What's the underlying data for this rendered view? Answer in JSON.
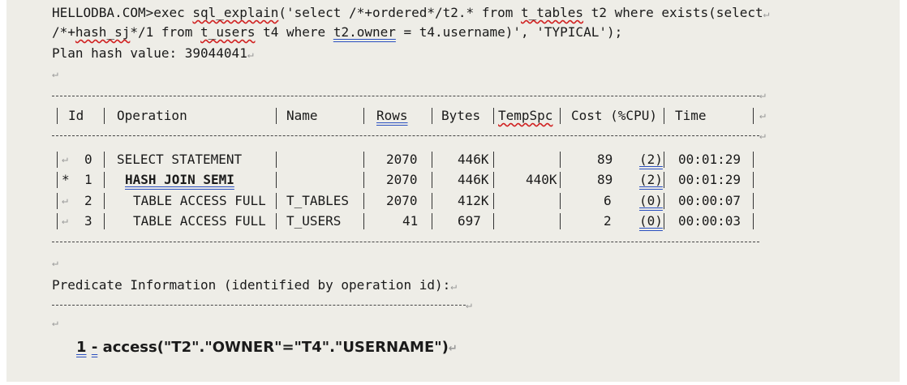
{
  "command": {
    "line1_prefix": "HELLODBA.COM>exec ",
    "line1_fn": "sql_explain",
    "line1_mid": "('select /*+ordered*/t2.* from ",
    "line1_tbl": "t_tables",
    "line1_end": " t2 where exists(select",
    "line2_pre": "/*+",
    "line2_hint": "hash_sj",
    "line2_mid": "*/1 from ",
    "line2_tbl": "t_users",
    "line2_mid2": " t4 where ",
    "line2_owner": "t2.owner",
    "line2_end": " = t4.username)', 'TYPICAL');"
  },
  "plan_hash": "Plan hash value: 39044041",
  "headers": {
    "id": "Id",
    "operation": "Operation",
    "name": "Name",
    "rows": "Rows",
    "bytes": "Bytes",
    "tempspc": "TempSpc",
    "cost": "Cost (%CPU)",
    "time": "Time"
  },
  "rows": [
    {
      "id": "0",
      "operation": "SELECT STATEMENT",
      "name": "",
      "rows": "2070",
      "bytes": "446K",
      "tempspc": "",
      "cost": "89",
      "cpu": "(2)",
      "time": "00:01:29"
    },
    {
      "id": "1",
      "operation": "HASH JOIN SEMI",
      "name": "",
      "rows": "2070",
      "bytes": "446K",
      "tempspc": "440K",
      "cost": "89",
      "cpu": "(2)",
      "time": "00:01:29"
    },
    {
      "id": "2",
      "operation": "TABLE ACCESS FULL",
      "name": "T_TABLES",
      "rows": "2070",
      "bytes": "412K",
      "tempspc": "",
      "cost": "6",
      "cpu": "(0)",
      "time": "00:00:07"
    },
    {
      "id": "3",
      "operation": "TABLE ACCESS FULL",
      "name": "T_USERS",
      "rows": "41",
      "bytes": "697",
      "tempspc": "",
      "cost": "2",
      "cpu": "(0)",
      "time": "00:00:03"
    }
  ],
  "predicate_title": "Predicate Information (identified by operation id):",
  "predicate": {
    "id": "1",
    "sep": "-",
    "text": "access(\"T2\".\"OWNER\"=\"T4\".\"USERNAME\")"
  },
  "marks": {
    "return": "↵",
    "star": "*"
  }
}
